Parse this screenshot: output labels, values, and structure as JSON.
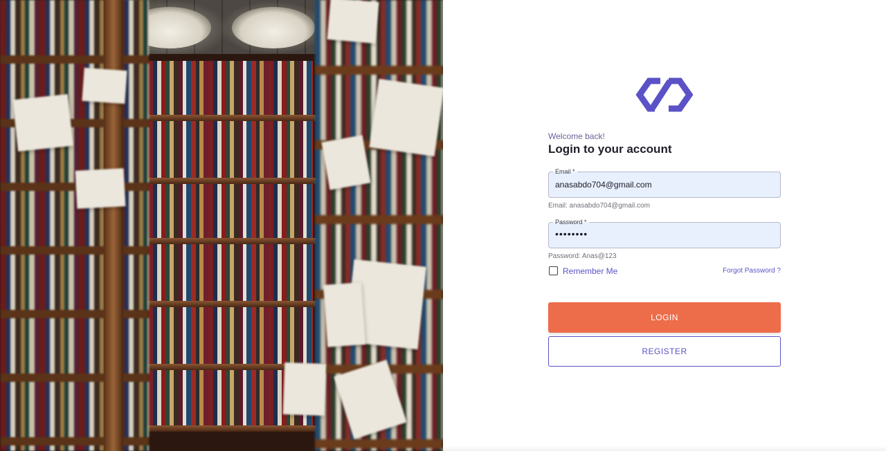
{
  "hero": {
    "image": "library-bookshelves-photo"
  },
  "brand": {
    "logo_icon": "link-infinity-logo-icon",
    "color": "#5b52c7"
  },
  "header": {
    "welcome": "Welcome back!",
    "title": "Login to your account"
  },
  "form": {
    "email": {
      "label": "Email *",
      "value": "anasabdo704@gmail.com",
      "hint": "Email: anasabdo704@gmail.com"
    },
    "password": {
      "label": "Password *",
      "masked_value": "••••••••",
      "hint": "Password: Anas@123"
    },
    "remember_me": {
      "label": "Remember Me",
      "checked": false
    },
    "forgot_password": "Forgot Password ?"
  },
  "actions": {
    "login": "LOGIN",
    "register": "REGISTER"
  },
  "colors": {
    "login_button": "#ed6d4a",
    "accent": "#5b52c7",
    "input_background": "#e8f0fe"
  }
}
